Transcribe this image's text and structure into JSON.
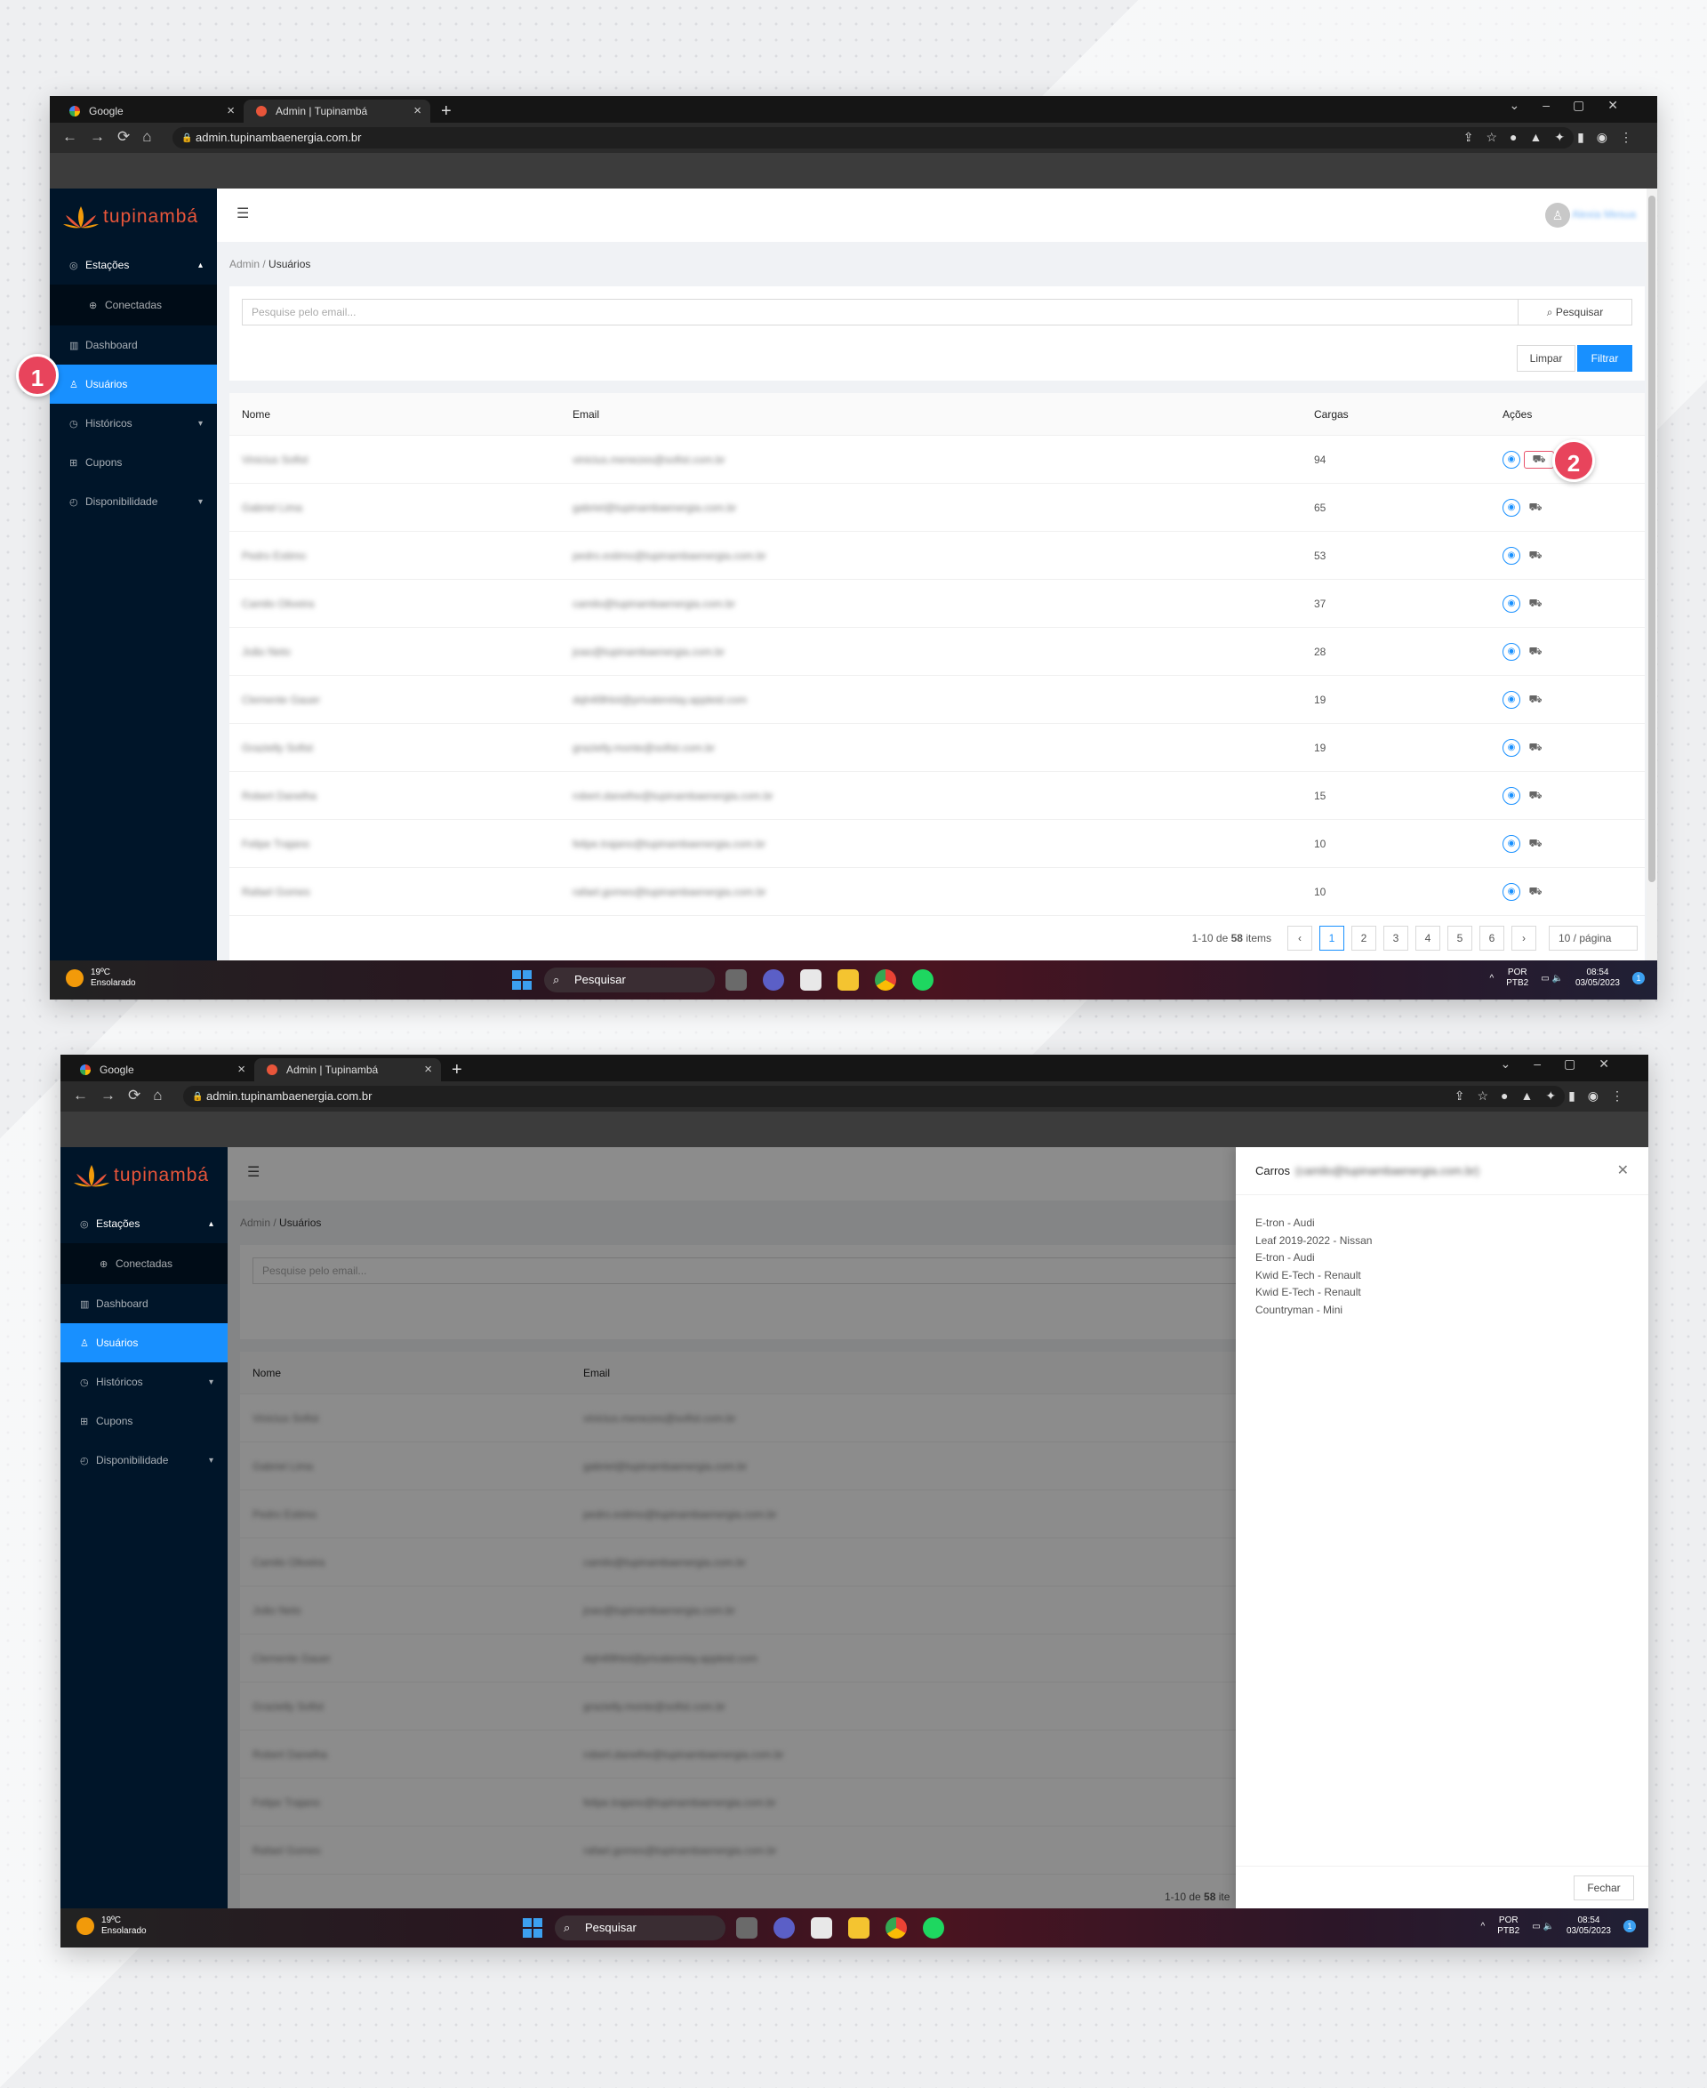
{
  "browser": {
    "tabs": [
      {
        "label": "Google"
      },
      {
        "label": "Admin | Tupinambá"
      }
    ],
    "url": "admin.tupinambaenergia.com.br"
  },
  "app": {
    "brand": "tupinambá",
    "user_name": "Alexia Mesua",
    "sidebar": [
      {
        "label": "Estações"
      },
      {
        "label": "Conectadas"
      },
      {
        "label": "Dashboard"
      },
      {
        "label": "Usuários"
      },
      {
        "label": "Históricos"
      },
      {
        "label": "Cupons"
      },
      {
        "label": "Disponibilidade"
      }
    ],
    "breadcrumb": {
      "root": "Admin",
      "sep": "/",
      "current": "Usuários"
    },
    "search": {
      "placeholder": "Pesquise pelo email...",
      "button": "Pesquisar"
    },
    "buttons": {
      "clear": "Limpar",
      "filter": "Filtrar"
    },
    "table": {
      "headers": [
        "Nome",
        "Email",
        "Cargas",
        "Ações"
      ],
      "rows": [
        {
          "name": "Vinicius Sofist",
          "email": "vinicius.menezes@sofist.com.br",
          "cargas": "94"
        },
        {
          "name": "Gabriel Lima",
          "email": "gabriel@tupinambaenergia.com.br",
          "cargas": "65"
        },
        {
          "name": "Pedro Estimo",
          "email": "pedro.estimo@tupinambaenergia.com.br",
          "cargas": "53"
        },
        {
          "name": "Camilo Oliveira",
          "email": "camilo@tupinambaenergia.com.br",
          "cargas": "37"
        },
        {
          "name": "João Neto",
          "email": "joao@tupinambaenergia.com.br",
          "cargas": "28"
        },
        {
          "name": "Clemente Gauer",
          "email": "dqh4l9hlol@privaterelay.appleid.com",
          "cargas": "19"
        },
        {
          "name": "Grazielly Sofist",
          "email": "grazielly.monte@sofist.com.br",
          "cargas": "19"
        },
        {
          "name": "Robert Danelha",
          "email": "robert.danelhe@tupinambaenergia.com.br",
          "cargas": "15"
        },
        {
          "name": "Felipe Trajano",
          "email": "felipe.trajano@tupinambaenergia.com.br",
          "cargas": "10"
        },
        {
          "name": "Rafael Gomes",
          "email": "rafael.gomes@tupinambaenergia.com.br",
          "cargas": "10"
        }
      ]
    },
    "pagination": {
      "range": "1-10 de",
      "total": "58",
      "items": "items",
      "pages": [
        "1",
        "2",
        "3",
        "4",
        "5",
        "6"
      ],
      "current": 1,
      "page_size": "10 / página"
    }
  },
  "drawer": {
    "title": "Carros",
    "email": "(camilo@tupinambaenergia.com.br)",
    "cars": [
      "E-tron - Audi",
      "Leaf 2019-2022 - Nissan",
      "E-tron - Audi",
      "Kwid E-Tech - Renault",
      "Kwid E-Tech - Renault",
      "Countryman - Mini"
    ],
    "close_button": "Fechar",
    "partial_pager_range": "1-10 de",
    "partial_pager_total": "58",
    "partial_pager_items": "ite"
  },
  "taskbar": {
    "temp": "19ºC",
    "weather": "Ensolarado",
    "search": "Pesquisar",
    "lang1": "POR",
    "lang2": "PTB2",
    "time": "08:54",
    "date": "03/05/2023",
    "notifications": "1"
  },
  "markers": [
    "1",
    "2"
  ],
  "colors": {
    "sider": "#001529",
    "primary": "#1890ff",
    "brand": "#e8553a",
    "marker": "#e8445c"
  }
}
